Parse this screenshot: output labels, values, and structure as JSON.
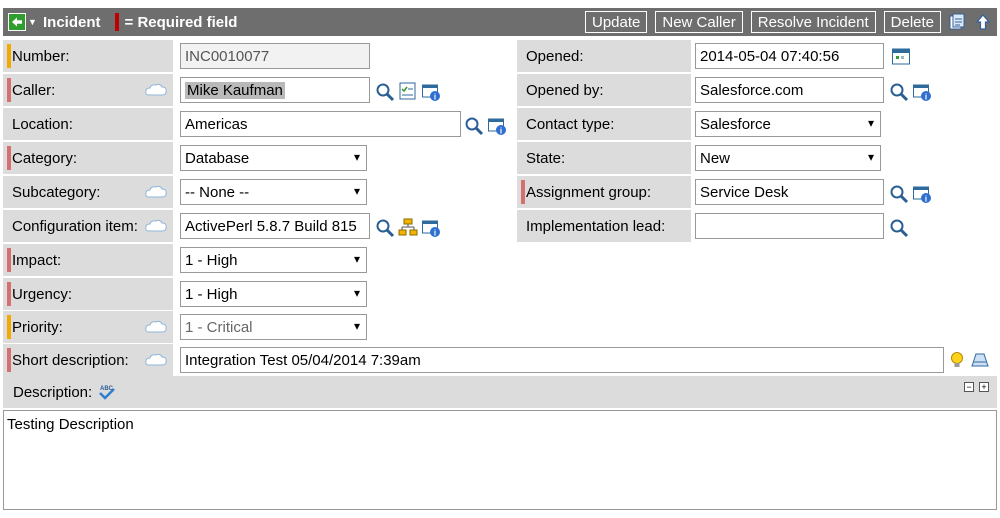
{
  "header": {
    "title": "Incident",
    "required_legend": "= Required field",
    "buttons": {
      "update": "Update",
      "new_caller": "New Caller",
      "resolve": "Resolve Incident",
      "delete": "Delete"
    }
  },
  "fields": {
    "number": {
      "label": "Number:",
      "value": "INC0010077"
    },
    "caller": {
      "label": "Caller:",
      "value": "Mike Kaufman"
    },
    "location": {
      "label": "Location:",
      "value": "Americas"
    },
    "category": {
      "label": "Category:",
      "value": "Database"
    },
    "subcategory": {
      "label": "Subcategory:",
      "value": "-- None --"
    },
    "config_item": {
      "label": "Configuration item:",
      "value": "ActivePerl 5.8.7 Build 815"
    },
    "impact": {
      "label": "Impact:",
      "value": "1 - High"
    },
    "urgency": {
      "label": "Urgency:",
      "value": "1 - High"
    },
    "priority": {
      "label": "Priority:",
      "value": "1 - Critical"
    },
    "short_description": {
      "label": "Short description:",
      "value": "Integration Test 05/04/2014 7:39am"
    },
    "opened": {
      "label": "Opened:",
      "value": "2014-05-04 07:40:56"
    },
    "opened_by": {
      "label": "Opened by:",
      "value": "Salesforce.com"
    },
    "contact_type": {
      "label": "Contact type:",
      "value": "Salesforce"
    },
    "state": {
      "label": "State:",
      "value": "New"
    },
    "assignment_group": {
      "label": "Assignment group:",
      "value": "Service Desk"
    },
    "implementation_lead": {
      "label": "Implementation lead:",
      "value": ""
    }
  },
  "description": {
    "label": "Description:",
    "value": "Testing Description"
  },
  "colors": {
    "header_bg": "#6e6e6e",
    "label_bg": "#dcdcdc",
    "required": "#d47070",
    "mandatory": "#f2a900"
  }
}
